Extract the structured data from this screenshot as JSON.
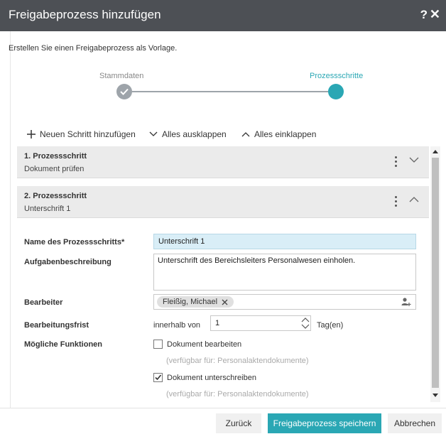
{
  "dialog": {
    "title": "Freigabeprozess hinzufügen",
    "help_label": "?",
    "close_label": "✕",
    "subtitle": "Erstellen Sie einen Freigabeprozess als Vorlage."
  },
  "stepper": {
    "steps": [
      {
        "label": "Stammdaten",
        "state": "completed"
      },
      {
        "label": "Prozessschritte",
        "state": "active"
      }
    ]
  },
  "toolbar": {
    "add_label": "Neuen Schritt hinzufügen",
    "expand_label": "Alles ausklappen",
    "collapse_label": "Alles einklappen"
  },
  "process_steps": [
    {
      "title": "1. Prozessschritt",
      "subtitle": "Dokument prüfen",
      "expanded": false
    },
    {
      "title": "2. Prozessschritt",
      "subtitle": "Unterschrift 1",
      "expanded": true
    }
  ],
  "form": {
    "name_label": "Name des Prozessschritts*",
    "name_value": "Unterschrift 1",
    "description_label": "Aufgabenbeschreibung",
    "description_value": "Unterschrift des Bereichsleiters Personalwesen einholen.",
    "assignee_label": "Bearbeiter",
    "assignee_chip": "Fleißig, Michael",
    "deadline_label": "Bearbeitungsfrist",
    "deadline_prefix": "innerhalb von",
    "deadline_value": "1",
    "deadline_unit": "Tag(en)",
    "functions_label": "Mögliche Funktionen",
    "functions": [
      {
        "label": "Dokument bearbeiten",
        "checked": false,
        "note": "(verfügbar für: Personalaktendokumente)"
      },
      {
        "label": "Dokument unterschreiben",
        "checked": true,
        "note": "(verfügbar für: Personalaktendokumente)"
      }
    ]
  },
  "footer": {
    "back_label": "Zurück",
    "save_label": "Freigabeprozess speichern",
    "cancel_label": "Abbrechen"
  },
  "colors": {
    "accent": "#2aa7b4",
    "titlebar": "#4d5055",
    "input_highlight": "#d9eef7"
  }
}
